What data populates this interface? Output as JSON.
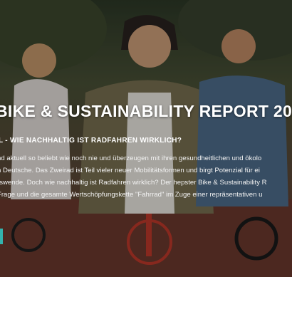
{
  "hero": {
    "title": "BIKE & SUSTAINABILITY REPORT 20",
    "subtitle": "L - WIE NACHHALTIG IST RADFAHREN WIRKLICH?",
    "paragraph_lines": [
      "nd aktuell so beliebt wie noch nie und überzeugen mit ihren gesundheitlichen und ökolo",
      "n Deutsche. Das Zweirad ist Teil vieler neuer Mobilitätsformen und birgt Potenzial für ei",
      "rswende. Doch wie nachhaltig ist Radfahren wirklich? Der hepster Bike & Sustainability R",
      "Frage und die gesamte Wertschöpfungskette \"Fahrrad\" im Zuge einer repräsentativen u"
    ]
  },
  "colors": {
    "accent": "#33b3ad",
    "text": "#ffffff"
  }
}
